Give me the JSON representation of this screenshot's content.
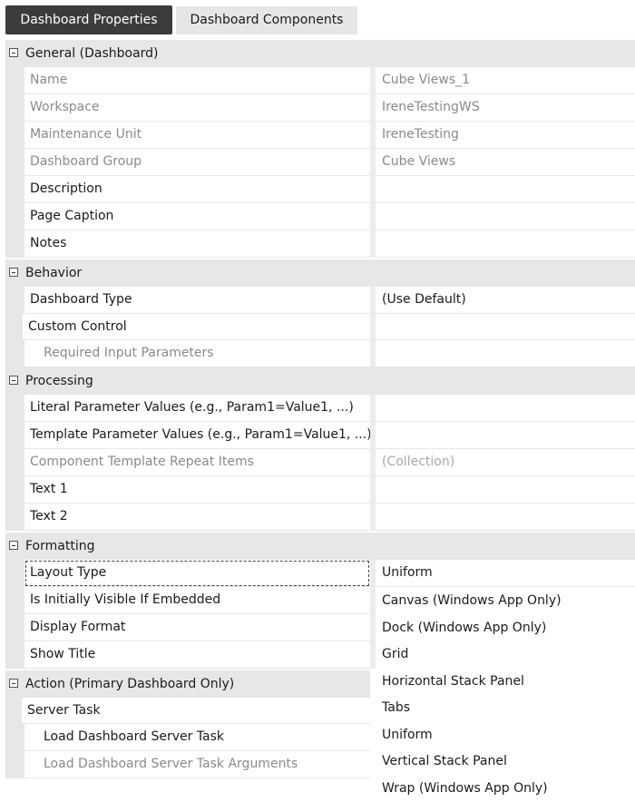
{
  "tabs": {
    "properties": "Dashboard Properties",
    "components": "Dashboard Components"
  },
  "categories": {
    "general": "General (Dashboard)",
    "behavior": "Behavior",
    "processing": "Processing",
    "formatting": "Formatting",
    "action": "Action (Primary Dashboard Only)"
  },
  "props": {
    "name": {
      "label": "Name",
      "value": "Cube Views_1"
    },
    "workspace": {
      "label": "Workspace",
      "value": "IreneTestingWS"
    },
    "maintenance_unit": {
      "label": "Maintenance Unit",
      "value": "IreneTesting"
    },
    "dashboard_group": {
      "label": "Dashboard Group",
      "value": "Cube Views"
    },
    "description": {
      "label": "Description",
      "value": ""
    },
    "page_caption": {
      "label": "Page Caption",
      "value": ""
    },
    "notes": {
      "label": "Notes",
      "value": ""
    },
    "dashboard_type": {
      "label": "Dashboard Type",
      "value": "(Use Default)"
    },
    "custom_control": {
      "label": "Custom Control",
      "value": ""
    },
    "required_input_params": {
      "label": "Required Input Parameters",
      "value": ""
    },
    "literal_params": {
      "label": "Literal Parameter Values (e.g., Param1=Value1, ...)",
      "value": ""
    },
    "template_params": {
      "label": "Template Parameter Values (e.g., Param1=Value1, ...)",
      "value": ""
    },
    "component_template_repeat": {
      "label": "Component Template Repeat Items",
      "value": "(Collection)"
    },
    "text1": {
      "label": "Text 1",
      "value": ""
    },
    "text2": {
      "label": "Text 2",
      "value": ""
    },
    "layout_type": {
      "label": "Layout Type",
      "value": "Uniform"
    },
    "initially_visible": {
      "label": "Is Initially Visible If Embedded"
    },
    "display_format": {
      "label": "Display Format"
    },
    "show_title": {
      "label": "Show Title"
    },
    "server_task": {
      "label": "Server Task"
    },
    "load_server_task": {
      "label": "Load Dashboard Server Task"
    },
    "load_server_task_args": {
      "label": "Load Dashboard Server Task Arguments"
    }
  },
  "layout_type_options": [
    "Canvas (Windows App Only)",
    "Dock (Windows App Only)",
    "Grid",
    "Horizontal Stack Panel",
    "Tabs",
    "Uniform",
    "Vertical Stack Panel",
    "Wrap (Windows App Only)"
  ]
}
